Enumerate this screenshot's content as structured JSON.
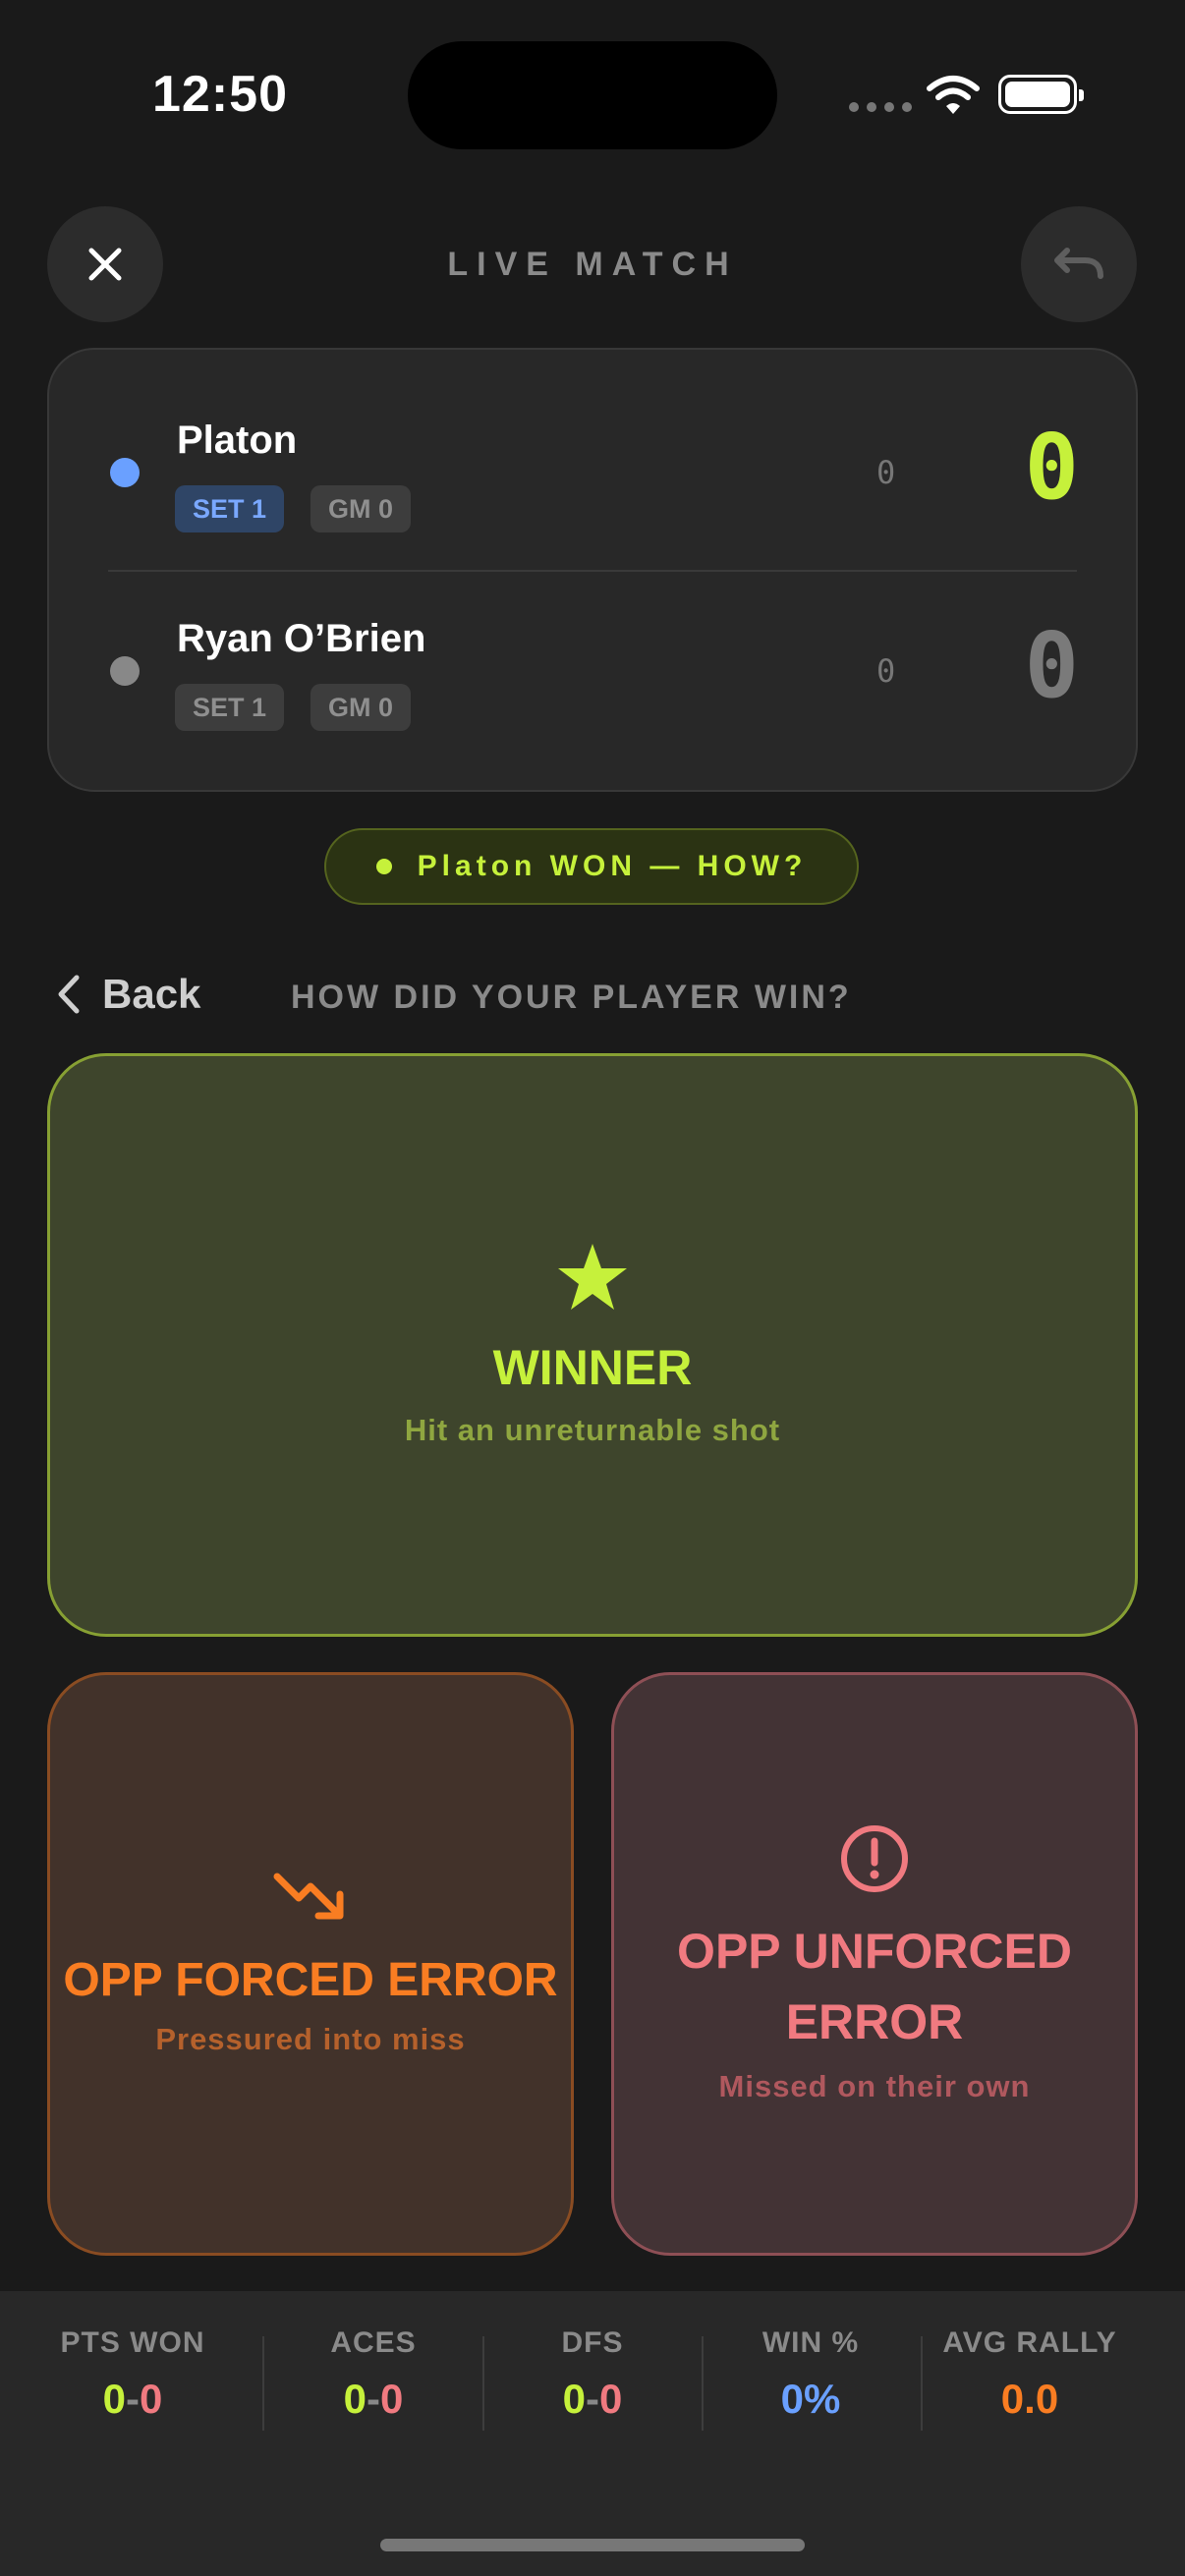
{
  "status_bar": {
    "time": "12:50"
  },
  "header": {
    "title": "LIVE MATCH"
  },
  "colors": {
    "accent": "#c6f13b",
    "blue": "#6aa0ff",
    "orange": "#f97d22",
    "red": "#f07a80"
  },
  "players": [
    {
      "name": "Platon",
      "set_badge": "SET 1",
      "game_badge": "GM 0",
      "games": "0",
      "points": "0",
      "serving": true
    },
    {
      "name": "Ryan O’Brien",
      "set_badge": "SET 1",
      "game_badge": "GM 0",
      "games": "0",
      "points": "0",
      "serving": false
    }
  ],
  "won_pill": {
    "text": "Platon WON — HOW?"
  },
  "nav": {
    "back_label": "Back",
    "question": "HOW DID YOUR PLAYER WIN?"
  },
  "options": {
    "winner": {
      "title": "WINNER",
      "subtitle": "Hit an unreturnable shot",
      "icon": "star-icon"
    },
    "forced": {
      "title": "OPP FORCED ERROR",
      "subtitle": "Pressured into miss",
      "icon": "trend-down-icon"
    },
    "unforced": {
      "title_line1": "OPP UNFORCED",
      "title_line2": "ERROR",
      "subtitle": "Missed on their own",
      "icon": "alert-circle-icon"
    }
  },
  "stats": {
    "pts_won": {
      "label": "PTS WON",
      "a": "0",
      "sep": "-",
      "b": "0"
    },
    "aces": {
      "label": "ACES",
      "a": "0",
      "sep": "-",
      "b": "0"
    },
    "dfs": {
      "label": "DFS",
      "a": "0",
      "sep": "-",
      "b": "0"
    },
    "win_pct": {
      "label": "WIN %",
      "value": "0%"
    },
    "avg_rally": {
      "label": "AVG RALLY",
      "value": "0.0"
    }
  }
}
